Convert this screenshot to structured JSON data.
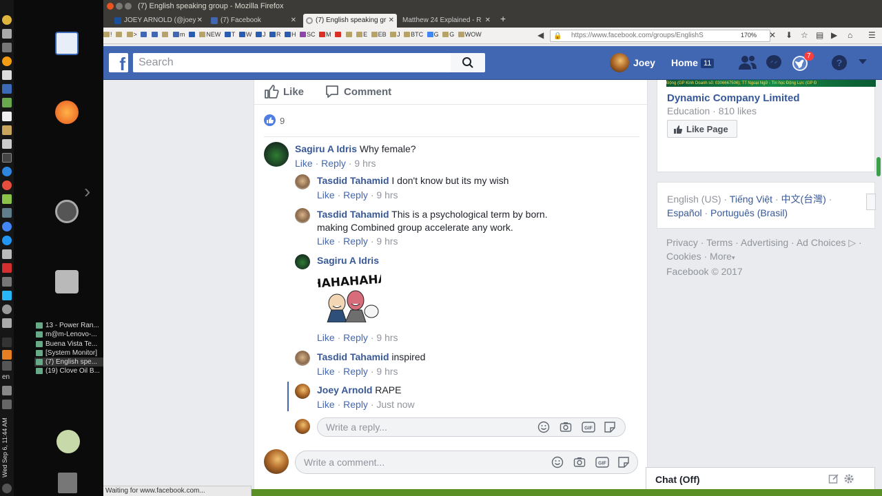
{
  "os": {
    "task_items": [
      "13 - Power Ran...",
      "m@m-Lenovo-...",
      "Buena Vista Te...",
      "[System Monitor]",
      "(7) English spe...",
      "(19) Clove Oil B..."
    ],
    "lang": "en",
    "clock": "Wed Sep 6, 11:44 AM"
  },
  "browser": {
    "window_title": "(7) English speaking group - Mozilla Firefox",
    "tabs": [
      {
        "label": "JOEY ARNOLD (@joey"
      },
      {
        "label": "(7) Facebook"
      },
      {
        "label": "(7) English speaking gr"
      },
      {
        "label": "Matthew 24 Explained - R"
      }
    ],
    "bookmarks": [
      "!",
      ">",
      "m",
      "NEW",
      "T",
      "W",
      "J",
      "R",
      "H",
      "SC",
      "M",
      "E",
      "EB",
      "J",
      "BTC",
      "G",
      "G",
      "WOW"
    ],
    "url": "https://www.facebook.com/groups/EnglishS",
    "zoom": "170%",
    "status_text": "Waiting for www.facebook.com..."
  },
  "fb_header": {
    "logo": "f",
    "search_placeholder": "Search",
    "user_name": "Joey",
    "home_label": "Home",
    "home_count": "11",
    "notif_count": "7"
  },
  "post": {
    "like_label": "Like",
    "comment_label": "Comment",
    "reaction_count": "9"
  },
  "comments": {
    "like": "Like",
    "reply": "Reply",
    "sep": "·",
    "c1": {
      "author": "Sagiru A Idris",
      "text": "Why female?",
      "time": "9 hrs"
    },
    "r1": {
      "author": "Tasdid Tahamid",
      "text": "I don't know but its my wish",
      "time": "9 hrs"
    },
    "r2": {
      "author": "Tasdid Tahamid",
      "text_line1": "This is a psychological term by born.",
      "text_line2": "making Combined group accelerate any work.",
      "time": "9 hrs"
    },
    "r3": {
      "author": "Sagiru A Idris",
      "sticker_text": "HAHAHAHA",
      "time": "9 hrs"
    },
    "r4": {
      "author": "Tasdid Tahamid",
      "text": "inspired",
      "time": "9 hrs"
    },
    "r5": {
      "author": "Joey Arnold",
      "text": "RAPE",
      "time": "Just now"
    },
    "reply_placeholder": "Write a reply...",
    "comment_placeholder": "Write a comment..."
  },
  "sidebar": {
    "ad_banner": "Động (GP Kinh Doanh số: 0306667506); TT Ngoại Ngữ - Tin học Động Lực (GP Đ",
    "ad_title": "Dynamic Company Limited",
    "ad_sub": "Education · 810 likes",
    "like_page": "Like Page",
    "lang_current": "English (US)",
    "lang_links": [
      "Tiếng Việt",
      "中文(台灣)",
      "Español",
      "Português (Brasil)"
    ],
    "footer_links": [
      "Privacy",
      "Terms",
      "Advertising",
      "Ad Choices",
      "Cookies",
      "More"
    ],
    "copyright": "Facebook © 2017"
  },
  "chat": {
    "label": "Chat (Off)"
  },
  "colors": {
    "fb_blue": "#4267b2",
    "link_blue": "#385898",
    "meta_gray": "#90949c"
  }
}
